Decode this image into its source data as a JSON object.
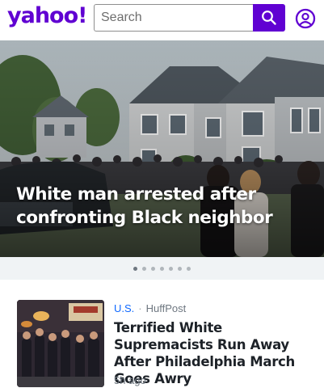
{
  "header": {
    "logo": "yahoo!",
    "search_placeholder": "Search",
    "search_icon": "search-icon",
    "profile_icon": "user-circle-icon"
  },
  "hero": {
    "headline": "White man arrested after confronting Black neighbor"
  },
  "carousel": {
    "total_slides": 7,
    "active_index": 0
  },
  "article": {
    "category": "U.S.",
    "separator": "·",
    "source": "HuffPost",
    "title": "Terrified White Supremacists Run Away After Philadelphia March Goes Awry",
    "time": "5h ago"
  },
  "colors": {
    "brand": "#6001d2",
    "category_link": "#0f69ff",
    "meta_text": "#6e7780",
    "title_text": "#1d2228"
  }
}
